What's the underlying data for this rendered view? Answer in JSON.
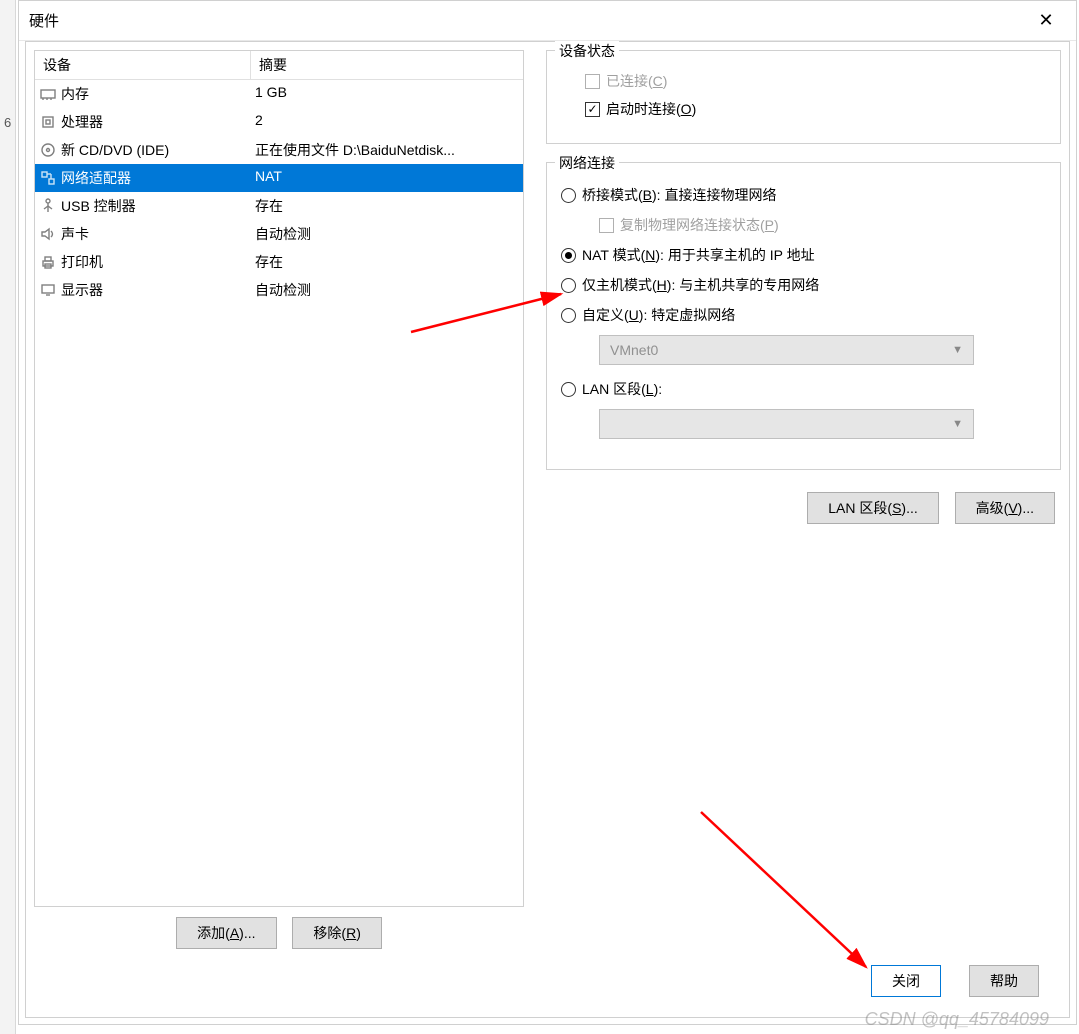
{
  "dialog": {
    "title": "硬件"
  },
  "tab": {
    "hardware": "硬件"
  },
  "table": {
    "headers": {
      "device": "设备",
      "summary": "摘要"
    },
    "rows": [
      {
        "icon": "memory",
        "name": "内存",
        "summary": "1 GB"
      },
      {
        "icon": "cpu",
        "name": "处理器",
        "summary": "2"
      },
      {
        "icon": "cd",
        "name": "新 CD/DVD (IDE)",
        "summary": "正在使用文件 D:\\BaiduNetdisk..."
      },
      {
        "icon": "net",
        "name": "网络适配器",
        "summary": "NAT",
        "selected": true
      },
      {
        "icon": "usb",
        "name": "USB 控制器",
        "summary": "存在"
      },
      {
        "icon": "sound",
        "name": "声卡",
        "summary": "自动检测"
      },
      {
        "icon": "printer",
        "name": "打印机",
        "summary": "存在"
      },
      {
        "icon": "display",
        "name": "显示器",
        "summary": "自动检测"
      }
    ]
  },
  "buttons": {
    "add": "添加(A)...",
    "remove": "移除(R)",
    "lan_segments": "LAN 区段(S)...",
    "advanced": "高级(V)...",
    "close": "关闭",
    "help": "帮助"
  },
  "deviceState": {
    "legend": "设备状态",
    "connected": "已连接(C)",
    "connect_at_power_on": "启动时连接(O)"
  },
  "networkConnection": {
    "legend": "网络连接",
    "bridged": "桥接模式(B): 直接连接物理网络",
    "replicate": "复制物理网络连接状态(P)",
    "nat": "NAT 模式(N): 用于共享主机的 IP 地址",
    "hostonly": "仅主机模式(H): 与主机共享的专用网络",
    "custom": "自定义(U): 特定虚拟网络",
    "custom_value": "VMnet0",
    "lan_segment": "LAN 区段(L):",
    "lan_value": ""
  },
  "watermark": "CSDN @qq_45784099",
  "bg_num": "6"
}
